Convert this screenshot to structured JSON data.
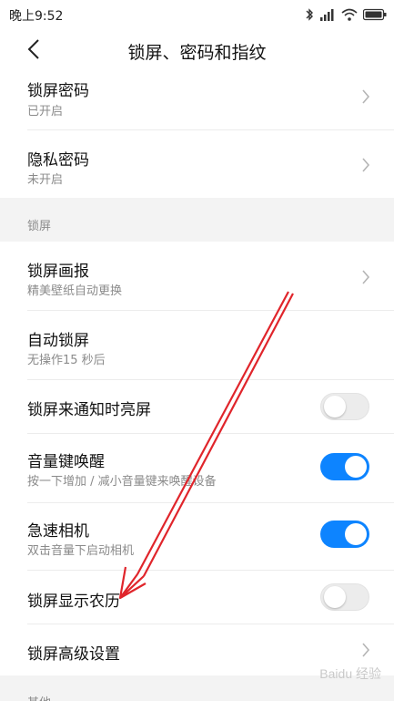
{
  "status_bar": {
    "time": "晚上9:52",
    "icons": [
      "bluetooth-icon",
      "signal-icon",
      "wifi-icon",
      "battery-icon"
    ]
  },
  "header": {
    "title": "锁屏、密码和指纹",
    "back_icon": "back-arrow-icon"
  },
  "rows": {
    "lock_password": {
      "title": "锁屏密码",
      "subtitle": "已开启"
    },
    "privacy_password": {
      "title": "隐私密码",
      "subtitle": "未开启"
    },
    "lock_section_label": "锁屏",
    "wallpaper": {
      "title": "锁屏画报",
      "subtitle": "精美壁纸自动更换"
    },
    "auto_lock": {
      "title": "自动锁屏",
      "subtitle": "无操作15 秒后"
    },
    "notify_wake": {
      "title": "锁屏来通知时亮屏",
      "toggle": "off"
    },
    "volume_wake": {
      "title": "音量键唤醒",
      "subtitle": "按一下增加 / 减小音量键来唤醒设备",
      "toggle": "on"
    },
    "quick_camera": {
      "title": "急速相机",
      "subtitle": "双击音量下启动相机",
      "toggle": "on"
    },
    "lunar": {
      "title": "锁屏显示农历",
      "toggle": "off"
    },
    "advanced": {
      "title": "锁屏高级设置"
    },
    "other_section_label": "其他"
  },
  "watermark": "Baidu 经验",
  "colors": {
    "accent": "#0d84ff",
    "annotation_arrow": "#e0252b",
    "section_gap": "#f3f3f3",
    "subtitle": "#8b8b8b"
  }
}
